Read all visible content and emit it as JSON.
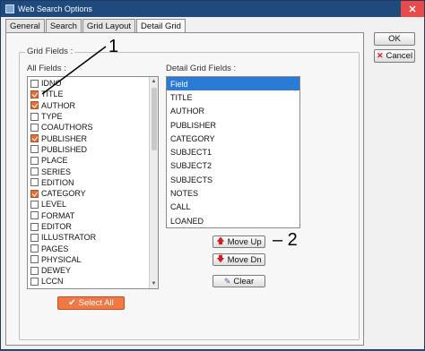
{
  "window": {
    "title": "Web Search Options",
    "close_label": "✕"
  },
  "tabs": [
    "General",
    "Search",
    "Grid Layout",
    "Detail Grid"
  ],
  "group": {
    "legend": "Grid Fields :"
  },
  "all_fields": {
    "label": "All Fields :",
    "items": [
      {
        "name": "IDNO",
        "checked": false
      },
      {
        "name": "TITLE",
        "checked": true
      },
      {
        "name": "AUTHOR",
        "checked": true
      },
      {
        "name": "TYPE",
        "checked": false
      },
      {
        "name": "COAUTHORS",
        "checked": false
      },
      {
        "name": "PUBLISHER",
        "checked": true
      },
      {
        "name": "PUBLISHED",
        "checked": false
      },
      {
        "name": "PLACE",
        "checked": false
      },
      {
        "name": "SERIES",
        "checked": false
      },
      {
        "name": "EDITION",
        "checked": false
      },
      {
        "name": "CATEGORY",
        "checked": true
      },
      {
        "name": "LEVEL",
        "checked": false
      },
      {
        "name": "FORMAT",
        "checked": false
      },
      {
        "name": "EDITOR",
        "checked": false
      },
      {
        "name": "ILLUSTRATOR",
        "checked": false
      },
      {
        "name": "PAGES",
        "checked": false
      },
      {
        "name": "PHYSICAL",
        "checked": false
      },
      {
        "name": "DEWEY",
        "checked": false
      },
      {
        "name": "LCCN",
        "checked": false
      }
    ]
  },
  "detail_fields": {
    "label": "Detail Grid Fields :",
    "header": "Field",
    "items": [
      "TITLE",
      "AUTHOR",
      "PUBLISHER",
      "CATEGORY",
      "SUBJECT1",
      "SUBJECT2",
      "SUBJECTS",
      "NOTES",
      "CALL",
      "LOANED"
    ]
  },
  "buttons": {
    "move_up": "Move Up",
    "move_dn": "Move Dn",
    "clear": "Clear",
    "select_all": "Select All",
    "ok": "OK",
    "cancel": "Cancel"
  },
  "annotations": {
    "one": "1",
    "two": "– 2"
  },
  "colors": {
    "titlebar": "#1f4a7d",
    "accent_orange": "#f07844",
    "selection_blue": "#2a7ad8"
  },
  "icons": {
    "move_up": "arrow-up-icon",
    "move_dn": "arrow-down-icon",
    "clear": "broom-icon",
    "select_all": "checkmark-icon",
    "cancel": "red-x-icon"
  }
}
